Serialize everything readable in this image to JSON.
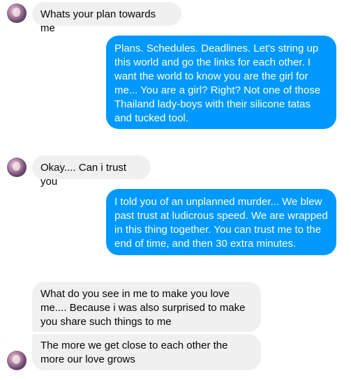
{
  "messages": [
    {
      "from": "them",
      "text": "Whats your plan towards me"
    },
    {
      "from": "me",
      "text": "Plans. Schedules. Deadlines. Let's string up this world and go the links for each other. I want the world to know you are the girl for me... You are a girl? Right? Not one of those Thailand lady-boys with their silicone tatas and tucked tool."
    },
    {
      "from": "them",
      "text": "Okay.... Can i trust you"
    },
    {
      "from": "me",
      "text": "I told you of an unplanned murder... We blew past trust at ludicrous speed. We are wrapped in this thing together. You can trust me to the end of time, and then 30 extra minutes."
    },
    {
      "from": "them",
      "text": "What do you see in me to make you love me.... Because i was also surprised to make you share such things to me"
    },
    {
      "from": "them",
      "text": "The more we get close to each other the more our love grows"
    }
  ],
  "colors": {
    "outgoing_bubble": "#0099ff",
    "incoming_bubble": "#f0f0f0",
    "outgoing_text": "#ffffff",
    "incoming_text": "#050505"
  },
  "icons": {
    "avatar": "contact-avatar"
  }
}
